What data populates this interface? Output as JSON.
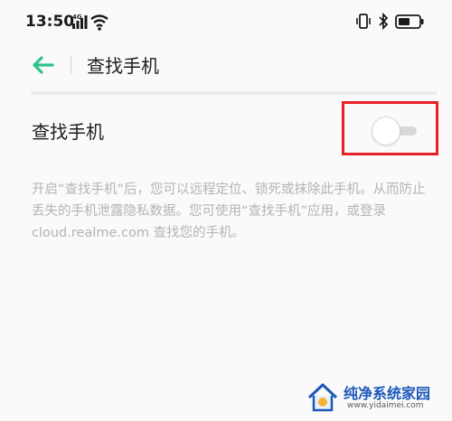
{
  "status_bar": {
    "time": "13:50",
    "network_label": "4G",
    "icons": [
      "signal-icon",
      "wifi-icon",
      "vibrate-icon",
      "bluetooth-icon",
      "battery-icon"
    ]
  },
  "header": {
    "title": "查找手机",
    "back_icon": "back-arrow-icon"
  },
  "setting": {
    "label": "查找手机",
    "toggle_state": "off"
  },
  "description": {
    "text": "开启“查找手机”后，您可以远程定位、锁死或抹除此手机。从而防止丢失的手机泄露隐私数据。您可使用“查找手机”应用，或登录 cloud.realme.com 查找您的手机。"
  },
  "watermark": {
    "title": "纯净系统家园",
    "url": "www.yidaimei.com"
  },
  "colors": {
    "accent_green": "#2fc28a",
    "highlight_red": "#e8202a",
    "description_gray": "#b4b4b4",
    "background": "#fafafa"
  }
}
